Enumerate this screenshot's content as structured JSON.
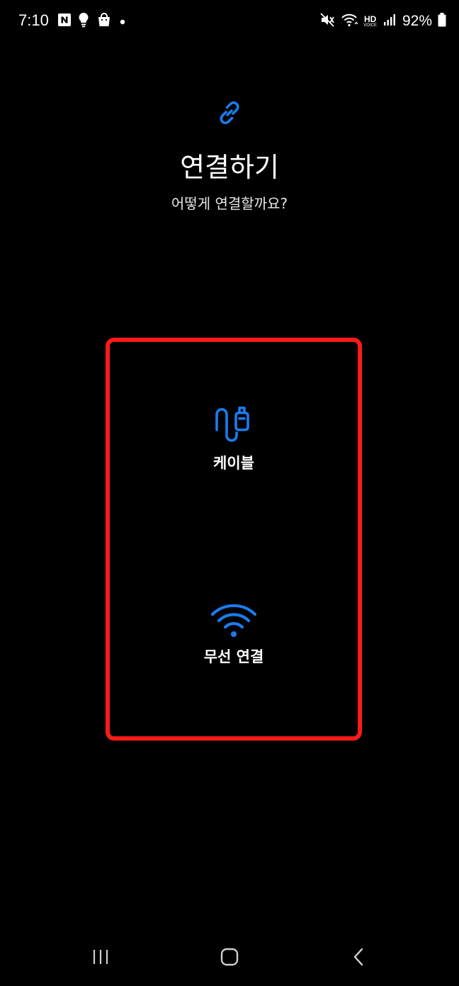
{
  "status_bar": {
    "time": "7:10",
    "battery_percent": "92%",
    "left_icons": [
      "naver-icon",
      "lightbulb-icon",
      "shopping-bag-icon",
      "notification-dot-icon"
    ],
    "right_icons": [
      "mute-icon",
      "wifi-icon",
      "hd-voice-icon",
      "signal-icon",
      "battery-icon"
    ],
    "hd_label": "HD",
    "voice_label": "VOICE"
  },
  "header": {
    "icon": "link-icon",
    "title": "연결하기",
    "subtitle": "어떻게 연결할까요?"
  },
  "options": [
    {
      "icon": "usb-cable-icon",
      "label": "케이블"
    },
    {
      "icon": "wifi-icon",
      "label": "무선 연결"
    }
  ],
  "navigation": {
    "recent_icon": "recent-apps-icon",
    "home_icon": "home-icon",
    "back_icon": "back-icon"
  },
  "colors": {
    "background": "#000000",
    "accent": "#1a7cf0",
    "highlight_border": "#ff1a1a",
    "text": "#ffffff"
  }
}
